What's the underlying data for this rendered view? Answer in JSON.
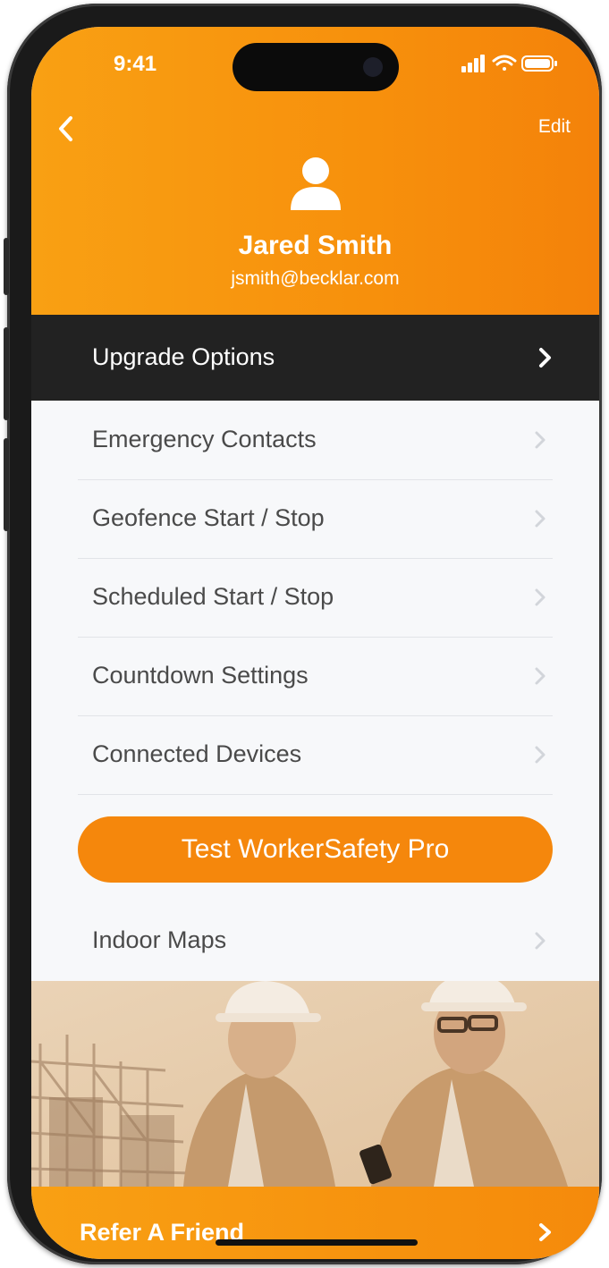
{
  "status_bar": {
    "time": "9:41"
  },
  "header": {
    "edit_label": "Edit",
    "user_name": "Jared Smith",
    "user_email": "jsmith@becklar.com"
  },
  "upgrade": {
    "label": "Upgrade Options"
  },
  "menu": {
    "items": [
      {
        "label": "Emergency Contacts"
      },
      {
        "label": "Geofence Start / Stop"
      },
      {
        "label": "Scheduled Start / Stop"
      },
      {
        "label": "Countdown Settings"
      },
      {
        "label": "Connected Devices"
      }
    ],
    "cta_label": "Test WorkerSafety Pro",
    "indoor_maps": "Indoor Maps"
  },
  "footer": {
    "refer_label": "Refer A Friend"
  },
  "colors": {
    "brand_orange": "#f7900c",
    "dark_row": "#222222",
    "cta": "#f5870c"
  },
  "icons": [
    "back-chevron-icon",
    "avatar-icon",
    "signal-icon",
    "wifi-icon",
    "battery-icon",
    "chevron-right-icon"
  ]
}
